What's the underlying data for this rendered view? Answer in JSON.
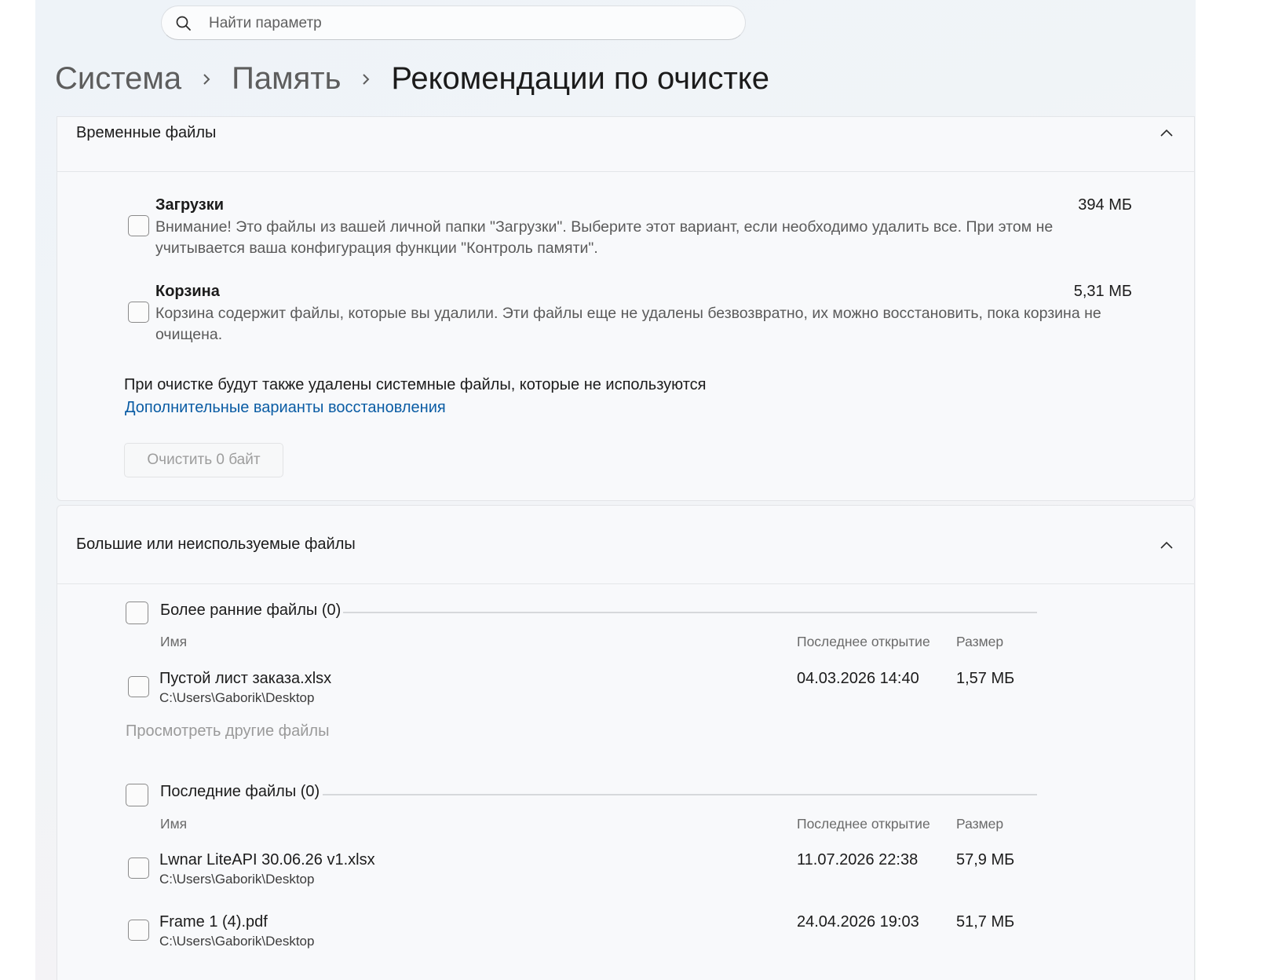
{
  "search": {
    "placeholder": "Найти параметр"
  },
  "breadcrumb": [
    "Система",
    "Память",
    "Рекомендации по очистке"
  ],
  "temp_files": {
    "title": "Временные файлы",
    "items": [
      {
        "title": "Загрузки",
        "size": "394 МБ",
        "description": "Внимание! Это файлы из вашей личной папки \"Загрузки\". Выберите этот вариант, если необходимо удалить все. При этом не учитывается ваша конфигурация функции \"Контроль памяти\"."
      },
      {
        "title": "Корзина",
        "size": "5,31 МБ",
        "description": "Корзина содержит файлы, которые вы удалили. Эти файлы еще не удалены безвозвратно, их можно восстановить, пока корзина не очищена."
      }
    ],
    "note": "При очистке будут также удалены системные файлы, которые не используются",
    "link": "Дополнительные варианты восстановления",
    "clean_button": "Очистить 0 байт"
  },
  "large_files": {
    "title": "Большие или неиспользуемые файлы",
    "columns": {
      "name": "Имя",
      "last_opened": "Последнее открытие",
      "size": "Размер"
    },
    "older": {
      "title": "Более ранние файлы (0)",
      "files": [
        {
          "name": "Пустой лист заказа.xlsx",
          "path": "C:\\Users\\Gaborik\\Desktop",
          "last_opened": "04.03.2026 14:40",
          "size": "1,57 МБ"
        }
      ],
      "more": "Просмотреть другие файлы"
    },
    "recent": {
      "title": "Последние файлы (0)",
      "files": [
        {
          "name": "Lwnar LiteAPI 30.06.26 v1.xlsx",
          "path": "C:\\Users\\Gaborik\\Desktop",
          "last_opened": "11.07.2026 22:38",
          "size": "57,9 МБ"
        },
        {
          "name": "Frame 1 (4).pdf",
          "path": "C:\\Users\\Gaborik\\Desktop",
          "last_opened": "24.04.2026 19:03",
          "size": "51,7 МБ"
        }
      ]
    }
  },
  "colors": {
    "link": "#0a5ca4",
    "text": "#1b1b1b",
    "secondary": "#5a5a5a",
    "disabled": "#9d9d9d"
  }
}
